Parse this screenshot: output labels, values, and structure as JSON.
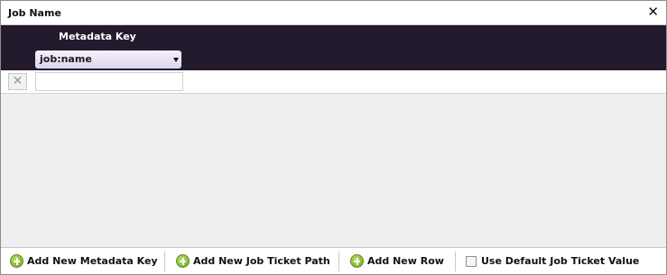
{
  "dialog": {
    "title": "Job Name",
    "close_glyph": "✕"
  },
  "table": {
    "column_header": "Metadata Key",
    "dropdown_value": "job:name",
    "rows": [
      {
        "delete_glyph": "✕",
        "value": ""
      }
    ]
  },
  "toolbar": {
    "add_metadata_key": "Add New Metadata Key",
    "add_job_ticket_path": "Add New Job Ticket Path",
    "add_row": "Add New Row",
    "use_default": "Use Default Job Ticket Value",
    "use_default_checked": false
  },
  "colors": {
    "header_bg": "#231a2e",
    "add_icon_green": "#7fb82a"
  },
  "icons": [
    "close-icon",
    "chevron-down-icon",
    "delete-icon",
    "plus-circle-icon",
    "checkbox"
  ]
}
